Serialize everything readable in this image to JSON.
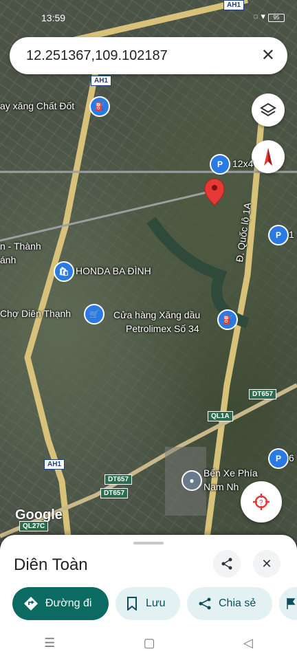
{
  "status": {
    "time": "13:59",
    "icons": "◌ ▾",
    "battery": "95"
  },
  "search": {
    "value": "12.251367,109.102187",
    "close_icon": "✕"
  },
  "map": {
    "labels": {
      "petrol1": "ay xăng Chất Đốt",
      "twelve": "12x4",
      "thanh": "n - Thành",
      "anh": "ánh",
      "honda": "HONDA BA ĐÌNH",
      "cho": "Chợ Diên Thạnh",
      "cuahang1": "Cửa hàng Xăng dầu",
      "cuahang2": "Petrolimex Số 34",
      "road": "Đ. Quốc lộ 1A",
      "ben1": "Bến Xe Phía",
      "ben2": "Nam Nh",
      "one": "1",
      "six": "6",
      "google": "Google"
    },
    "shields": {
      "ah1_top": "AH1",
      "ah1_mid": "AH1",
      "ah1_bot": "AH1",
      "dt657_a": "DT657",
      "dt657_b": "DT657",
      "dt657_c": "DT657",
      "ql1a": "QL1A",
      "ql27c": "QL27C"
    }
  },
  "sheet": {
    "place_name": "Diên Toàn",
    "directions": "Đường đi",
    "save": "Lưu",
    "share": "Chia sẻ"
  },
  "colors": {
    "primary": "#0b6b62",
    "chip": "#e3f1f3",
    "pin": "#e53935",
    "poi": "#2a7ae3"
  }
}
